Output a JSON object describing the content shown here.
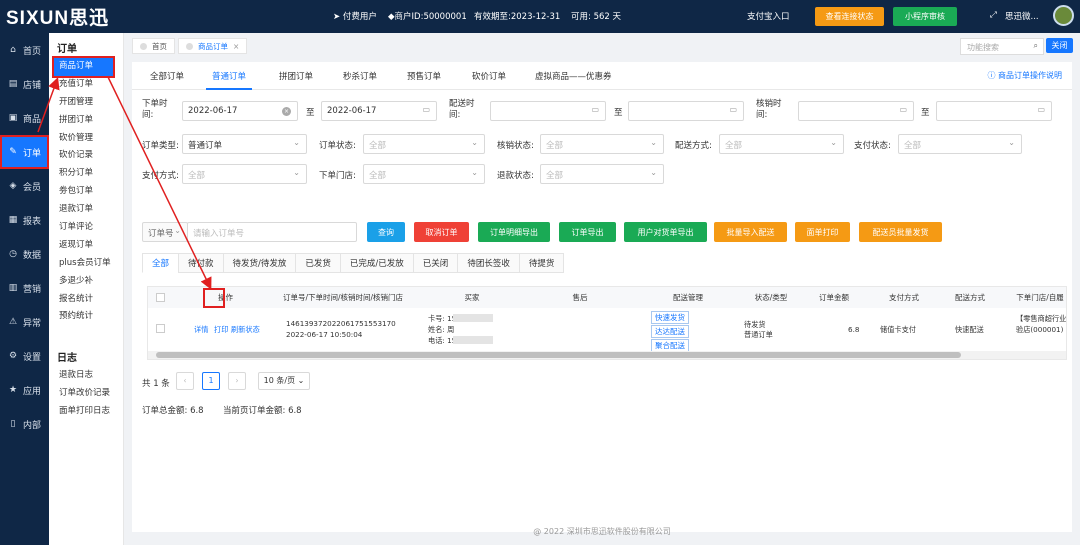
{
  "top": {
    "logo": "SIXUN思迅",
    "paid_user": "付费用户",
    "merchant_id": "商户ID:50000001",
    "expiry": "有效期至:2023-12-31",
    "available": "可用: 562 天",
    "alipay": "支付宝入口",
    "check_status": "查看连接状态",
    "mini_program": "小程序审核",
    "user": "思迅微...",
    "colors": {
      "topbar": "#0f2746",
      "orange": "#f59a14",
      "green": "#1aaa55"
    }
  },
  "left_nav": [
    {
      "label": "首页",
      "icon": "home-icon"
    },
    {
      "label": "店铺",
      "icon": "store-icon"
    },
    {
      "label": "商品",
      "icon": "gift-icon"
    },
    {
      "label": "订单",
      "icon": "order-icon"
    },
    {
      "label": "会员",
      "icon": "member-icon"
    },
    {
      "label": "报表",
      "icon": "report-icon"
    },
    {
      "label": "数据",
      "icon": "data-icon"
    },
    {
      "label": "营销",
      "icon": "marketing-icon"
    },
    {
      "label": "异常",
      "icon": "exception-icon"
    },
    {
      "label": "设置",
      "icon": "gear-icon"
    },
    {
      "label": "应用",
      "icon": "star-icon"
    },
    {
      "label": "内部",
      "icon": "document-icon"
    }
  ],
  "sub_nav": {
    "order_header": "订单",
    "order_items": [
      "商品订单",
      "充值订单",
      "开团管理",
      "拼团订单",
      "砍价管理",
      "砍价记录",
      "积分订单",
      "劵包订单",
      "退款订单",
      "订单评论",
      "返现订单",
      "plus会员订单",
      "多退少补",
      "报名统计",
      "预约统计"
    ],
    "log_header": "日志",
    "log_items": [
      "退款日志",
      "订单改价记录",
      "面单打印日志"
    ]
  },
  "page_tabs": {
    "home": "首页",
    "current": "商品订单",
    "close": "×"
  },
  "function_search_placeholder": "功能搜索",
  "close_label": "关闭",
  "order_tabs": [
    "全部订单",
    "普通订单",
    "拼团订单",
    "秒杀订单",
    "预售订单",
    "砍价订单",
    "虚拟商品——优惠券"
  ],
  "help_link": "商品订单操作说明",
  "filters": {
    "order_time_label": "下单时间:",
    "start_date": "2022-06-17",
    "to": "至",
    "end_date": "2022-06-17",
    "delivery_time_label": "配送时间:",
    "verify_time_label": "核销时间:",
    "order_type_label": "订单类型:",
    "order_type_value": "普通订单",
    "order_status_label": "订单状态:",
    "all": "全部",
    "verify_status_label": "核销状态:",
    "delivery_method_label": "配送方式:",
    "pay_status_label": "支付状态:",
    "pay_method_label": "支付方式:",
    "store_label": "下单门店:",
    "refund_status_label": "退款状态:",
    "order_no_select": "订单号",
    "order_no_placeholder": "请输入订单号"
  },
  "actions": [
    "查询",
    "取消订单",
    "订单明细导出",
    "订单导出",
    "用户对货单导出",
    "批量导入配送",
    "面单打印",
    "配送员批量发货"
  ],
  "status_tabs": [
    "全部",
    "待付款",
    "待发货/待发放",
    "已发货",
    "已完成/已发放",
    "已关闭",
    "待团长签收",
    "待提货"
  ],
  "table": {
    "headers": [
      "操作",
      "订单号/下单时间/核销时间/核销门店",
      "买家",
      "售后",
      "配送管理",
      "状态/类型",
      "订单金额",
      "支付方式",
      "配送方式",
      "下单门店/自履"
    ],
    "row": {
      "op_detail": "详情",
      "op_print": "打印",
      "op_flush": "刷新状态",
      "order_no": "1461393720220617515531​70",
      "order_time": "2022-06-17 10:50:04",
      "card": "卡号: 15",
      "name": "姓名: 周",
      "phone": "电话: 15",
      "delivery_btns": [
        "快速发货",
        "达达配送",
        "聚合配送"
      ],
      "status": "待发货",
      "type": "普通订单",
      "amount": "6.8",
      "pay_method": "储值卡支付",
      "delivery_method": "快速配送",
      "store_line1": "【零售商超行业",
      "store_line2": "验店(000001)"
    }
  },
  "pagination": {
    "total": "共 1 条",
    "page": "1",
    "page_size": "10 条/页"
  },
  "summary": {
    "total": "订单总金额: 6.8",
    "page_total": "当前页订单金额: 6.8"
  },
  "footer": "@ 2022 深圳市思迅软件股份有限公司"
}
